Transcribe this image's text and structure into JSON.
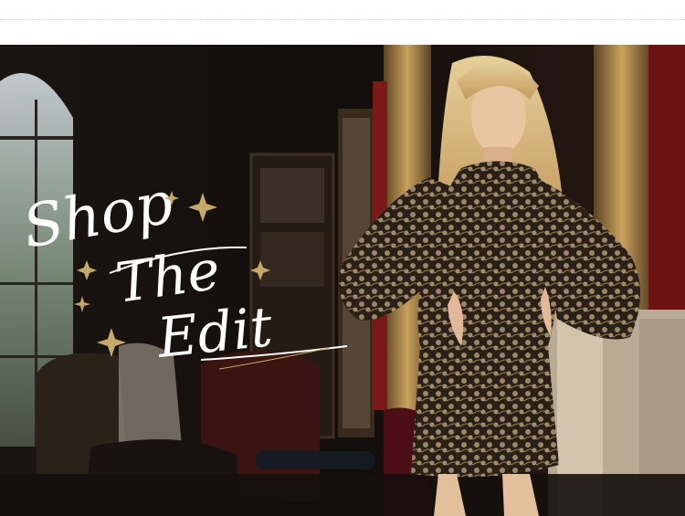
{
  "banner": {
    "headline_line1": "Shop",
    "headline_line2": "The",
    "headline_line3": "Edit"
  },
  "colors": {
    "background": "#ffffff",
    "divider": "#d8c9b8",
    "gold": "#c8a86a",
    "dress": "#1a1511"
  },
  "icons": [
    "sparkle-icon"
  ]
}
